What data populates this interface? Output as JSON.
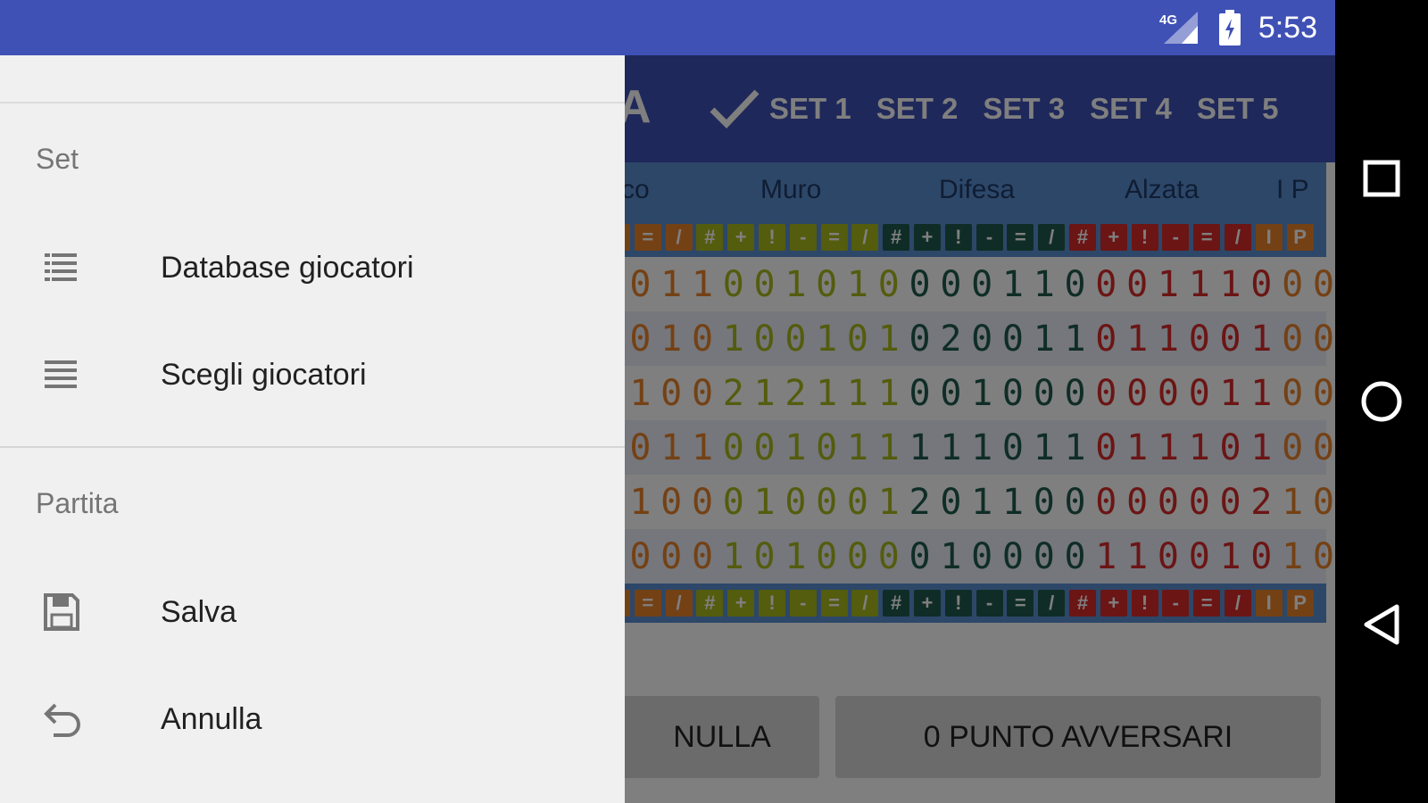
{
  "status_bar": {
    "time": "5:53",
    "network": "4G"
  },
  "drawer": {
    "sections": [
      {
        "title": "Set",
        "items": [
          {
            "label": "Database giocatori",
            "icon": "list-icon"
          },
          {
            "label": "Scegli giocatori",
            "icon": "list-icon"
          }
        ]
      },
      {
        "title": "Partita",
        "items": [
          {
            "label": "Salva",
            "icon": "save-icon"
          },
          {
            "label": "Annulla",
            "icon": "undo-icon"
          }
        ]
      }
    ]
  },
  "app": {
    "title_fragment": "A",
    "tabs": [
      "SET 1",
      "SET 2",
      "SET 3",
      "SET 4",
      "SET 5"
    ],
    "active_tab": "SET 1",
    "columns": [
      "co",
      "Muro",
      "Difesa",
      "Alzata",
      "I P"
    ],
    "symbols": [
      "=",
      "/",
      "#",
      "+",
      "!",
      "-",
      "=",
      "/",
      "#",
      "+",
      "!",
      "-",
      "=",
      "/",
      "#",
      "+",
      "!",
      "-",
      "=",
      "/",
      "I",
      "P"
    ],
    "rows": [
      [
        "0",
        "1",
        "1",
        "0",
        "0",
        "1",
        "0",
        "1",
        "0",
        "0",
        "0",
        "0",
        "1",
        "1",
        "0",
        "0",
        "0",
        "1",
        "1",
        "1",
        "0",
        "0",
        "0"
      ],
      [
        "0",
        "1",
        "0",
        "1",
        "0",
        "0",
        "1",
        "0",
        "1",
        "0",
        "2",
        "0",
        "0",
        "1",
        "1",
        "0",
        "1",
        "1",
        "0",
        "0",
        "1",
        "0",
        "0"
      ],
      [
        "1",
        "0",
        "0",
        "2",
        "1",
        "2",
        "1",
        "1",
        "1",
        "0",
        "0",
        "1",
        "0",
        "0",
        "0",
        "0",
        "0",
        "0",
        "0",
        "1",
        "1",
        "0",
        "0"
      ],
      [
        "0",
        "1",
        "1",
        "0",
        "0",
        "1",
        "0",
        "1",
        "1",
        "1",
        "1",
        "1",
        "0",
        "1",
        "1",
        "0",
        "1",
        "1",
        "1",
        "0",
        "1",
        "0",
        "0"
      ],
      [
        "1",
        "0",
        "0",
        "0",
        "1",
        "0",
        "0",
        "0",
        "1",
        "2",
        "0",
        "1",
        "1",
        "0",
        "0",
        "0",
        "0",
        "0",
        "0",
        "0",
        "2",
        "1",
        "0"
      ],
      [
        "0",
        "0",
        "0",
        "1",
        "0",
        "1",
        "0",
        "0",
        "0",
        "0",
        "1",
        "0",
        "0",
        "0",
        "0",
        "1",
        "1",
        "0",
        "0",
        "1",
        "0",
        "1",
        "0"
      ]
    ],
    "buttons": {
      "annulla": "NULLA",
      "punto": "0 PUNTO AVVERSARI"
    },
    "colors": {
      "primary": "#3f51b5",
      "attack": "#e8832a",
      "muro": "#a9b91c",
      "difesa": "#1e5a4c",
      "alzata": "#d62b2b"
    }
  }
}
